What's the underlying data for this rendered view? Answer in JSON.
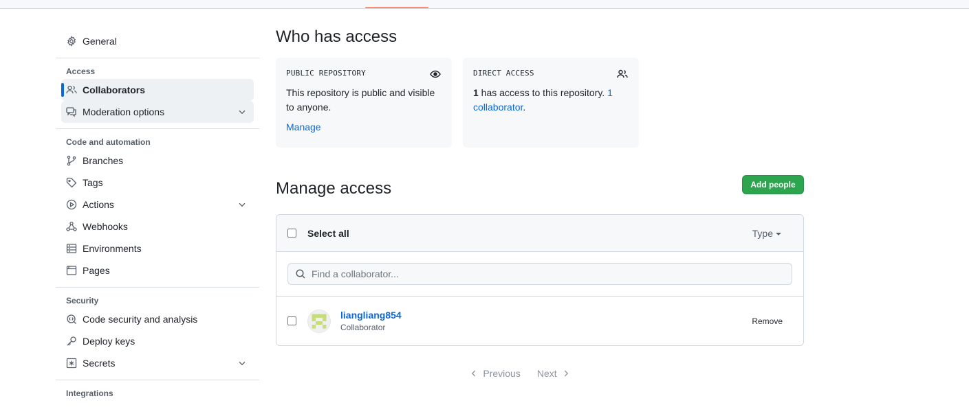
{
  "sidebar": {
    "general": "General",
    "sections": {
      "access": "Access",
      "code_automation": "Code and automation",
      "security": "Security",
      "integrations": "Integrations"
    },
    "access_items": [
      "Collaborators",
      "Moderation options"
    ],
    "code_items": [
      "Branches",
      "Tags",
      "Actions",
      "Webhooks",
      "Environments",
      "Pages"
    ],
    "security_items": [
      "Code security and analysis",
      "Deploy keys",
      "Secrets"
    ]
  },
  "who_has_access": {
    "title": "Who has access",
    "public_card": {
      "label": "PUBLIC REPOSITORY",
      "text": "This repository is public and visible to anyone.",
      "link": "Manage"
    },
    "direct_card": {
      "label": "DIRECT ACCESS",
      "count": "1",
      "text": " has access to this repository. ",
      "link": "1 collaborator",
      "period": "."
    }
  },
  "manage_access": {
    "title": "Manage access",
    "add_button": "Add people",
    "select_all": "Select all",
    "type_filter": "Type",
    "search_placeholder": "Find a collaborator...",
    "collaborators": [
      {
        "username": "liangliang854",
        "role": "Collaborator",
        "action": "Remove"
      }
    ],
    "pagination": {
      "previous": "Previous",
      "next": "Next"
    }
  },
  "colors": {
    "accent": "#0969da",
    "primary_button": "#2da44e",
    "tab_underline": "#fd8c73"
  }
}
